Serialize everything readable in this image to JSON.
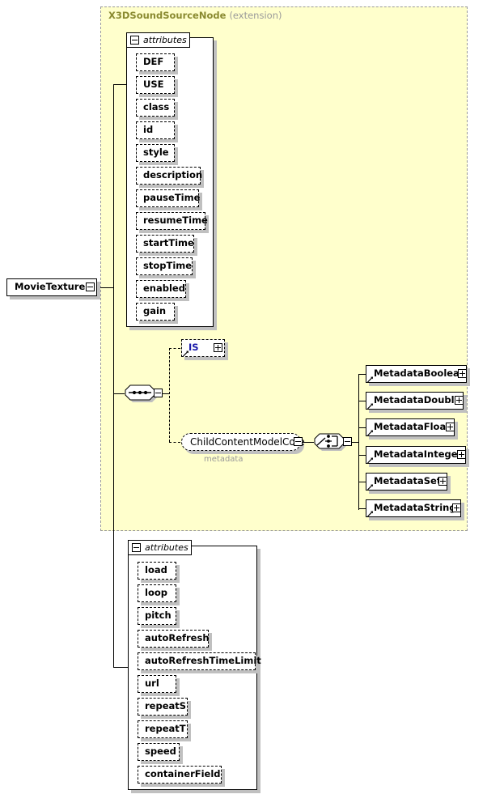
{
  "diagram": {
    "type": "xsd-schema-diagram",
    "root_element": {
      "label": "MovieTexture",
      "expander": "minus"
    },
    "extension_region": {
      "title": "X3DSoundSourceNode",
      "subtitle": "(extension)",
      "title_color": "#8a8a30",
      "background_color": "#ffffcc",
      "border_color": "#9a9a9a"
    },
    "inherited_attributes": {
      "header_label": "attributes",
      "expander": "minus",
      "items": [
        {
          "label": "DEF"
        },
        {
          "label": "USE"
        },
        {
          "label": "class"
        },
        {
          "label": "id"
        },
        {
          "label": "style"
        },
        {
          "label": "description"
        },
        {
          "label": "pauseTime"
        },
        {
          "label": "resumeTime"
        },
        {
          "label": "startTime"
        },
        {
          "label": "stopTime"
        },
        {
          "label": "enabled"
        },
        {
          "label": "gain"
        }
      ]
    },
    "sequence_compositor": {
      "kind": "sequence",
      "expander": "minus"
    },
    "is_element": {
      "label": "IS",
      "expander": "plus",
      "text_color": "#1a1aaa"
    },
    "group_reference": {
      "label": "ChildContentModelCore",
      "expander": "minus",
      "caption": "metadata"
    },
    "choice_compositor": {
      "kind": "choice",
      "expander": "minus"
    },
    "metadata_elements": [
      {
        "label": "MetadataBoolean",
        "expander": "plus"
      },
      {
        "label": "MetadataDouble",
        "expander": "plus"
      },
      {
        "label": "MetadataFloat",
        "expander": "plus"
      },
      {
        "label": "MetadataInteger",
        "expander": "plus"
      },
      {
        "label": "MetadataSet",
        "expander": "plus"
      },
      {
        "label": "MetadataString",
        "expander": "plus"
      }
    ],
    "own_attributes": {
      "header_label": "attributes",
      "expander": "minus",
      "items": [
        {
          "label": "load"
        },
        {
          "label": "loop"
        },
        {
          "label": "pitch"
        },
        {
          "label": "autoRefresh"
        },
        {
          "label": "autoRefreshTimeLimit"
        },
        {
          "label": "url"
        },
        {
          "label": "repeatS"
        },
        {
          "label": "repeatT"
        },
        {
          "label": "speed"
        },
        {
          "label": "containerField"
        }
      ]
    }
  }
}
